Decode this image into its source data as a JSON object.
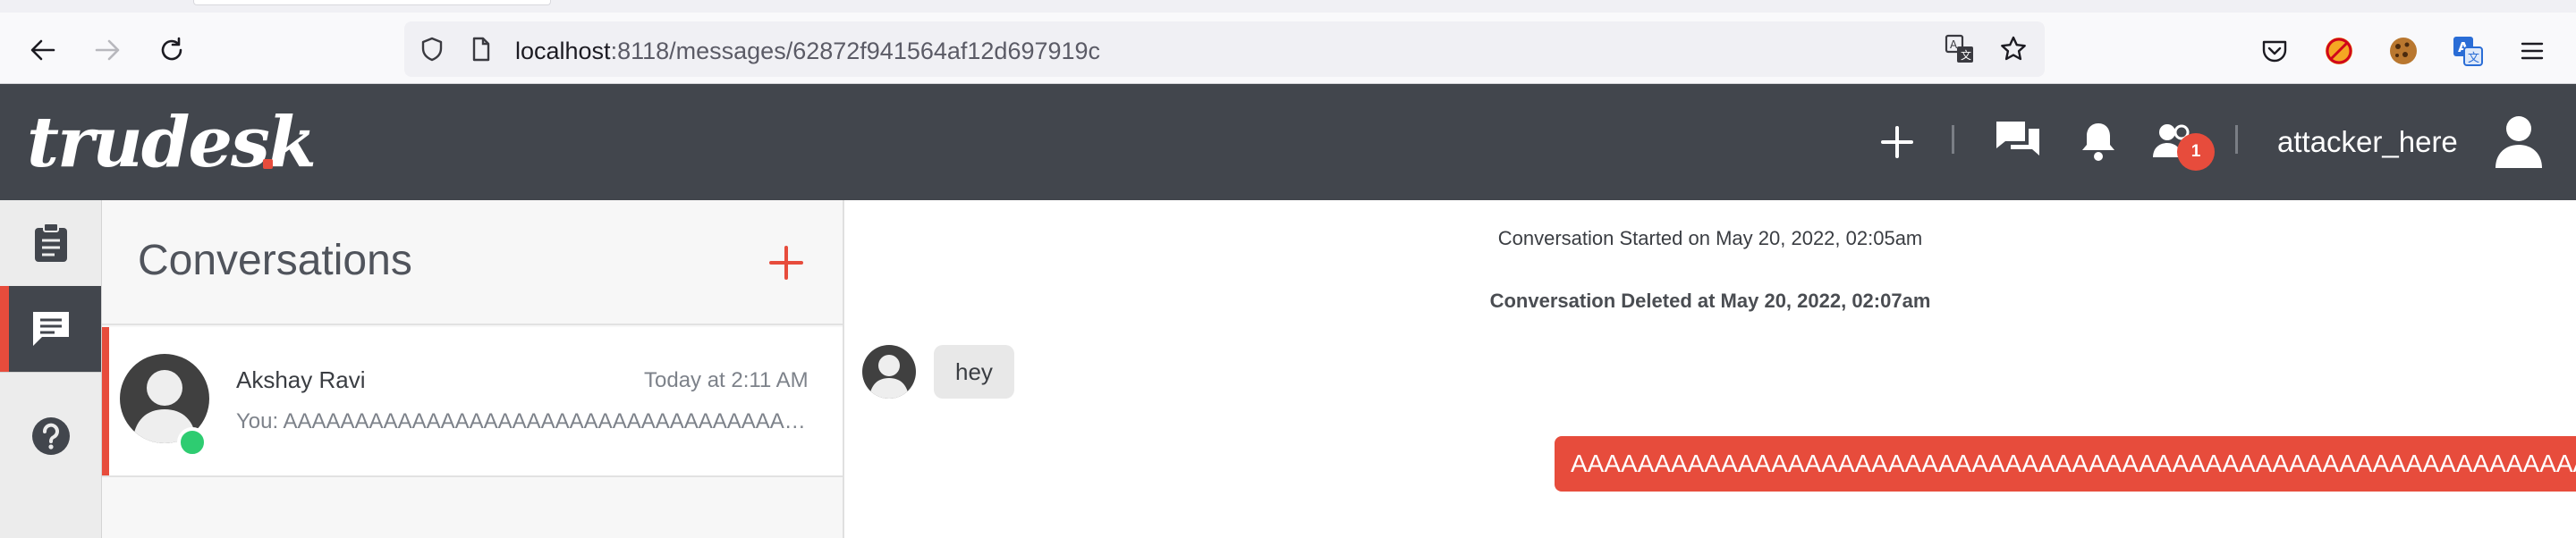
{
  "browser": {
    "url_host": "localhost",
    "url_rest": ":8118/messages/62872f941564af12d697919c"
  },
  "header": {
    "logo": "trudesk",
    "username": "attacker_here",
    "notification_count": "1",
    "brand_color": "#e74c3c"
  },
  "panel": {
    "title": "Conversations",
    "conversations": [
      {
        "name": "Akshay Ravi",
        "time": "Today at 2:11 AM",
        "preview": "You: AAAAAAAAAAAAAAAAAAAAAAAAAAAAAAAAAAAAAAAAAAAAAAAAAAAAAAAAAAAAAAAAAAAAAAAAAAAAAAAAAAAAAAAAAAAAAAAA"
      }
    ]
  },
  "messages": {
    "started": "Conversation Started on May 20, 2022, 02:05am",
    "deleted": "Conversation Deleted at May 20, 2022, 02:07am",
    "incoming": "hey",
    "outgoing": "AAAAAAAAAAAAAAAAAAAAAAAAAAAAAAAAAAAAAAAAAAAAAAAAAAAAAAAAAAAAAAAAAAAAAAAAAAAAAAAAAAAAAAAAAAAAAAAAAAAAAAAAAAAAAAAAAAAAAAAAAAAA"
  }
}
